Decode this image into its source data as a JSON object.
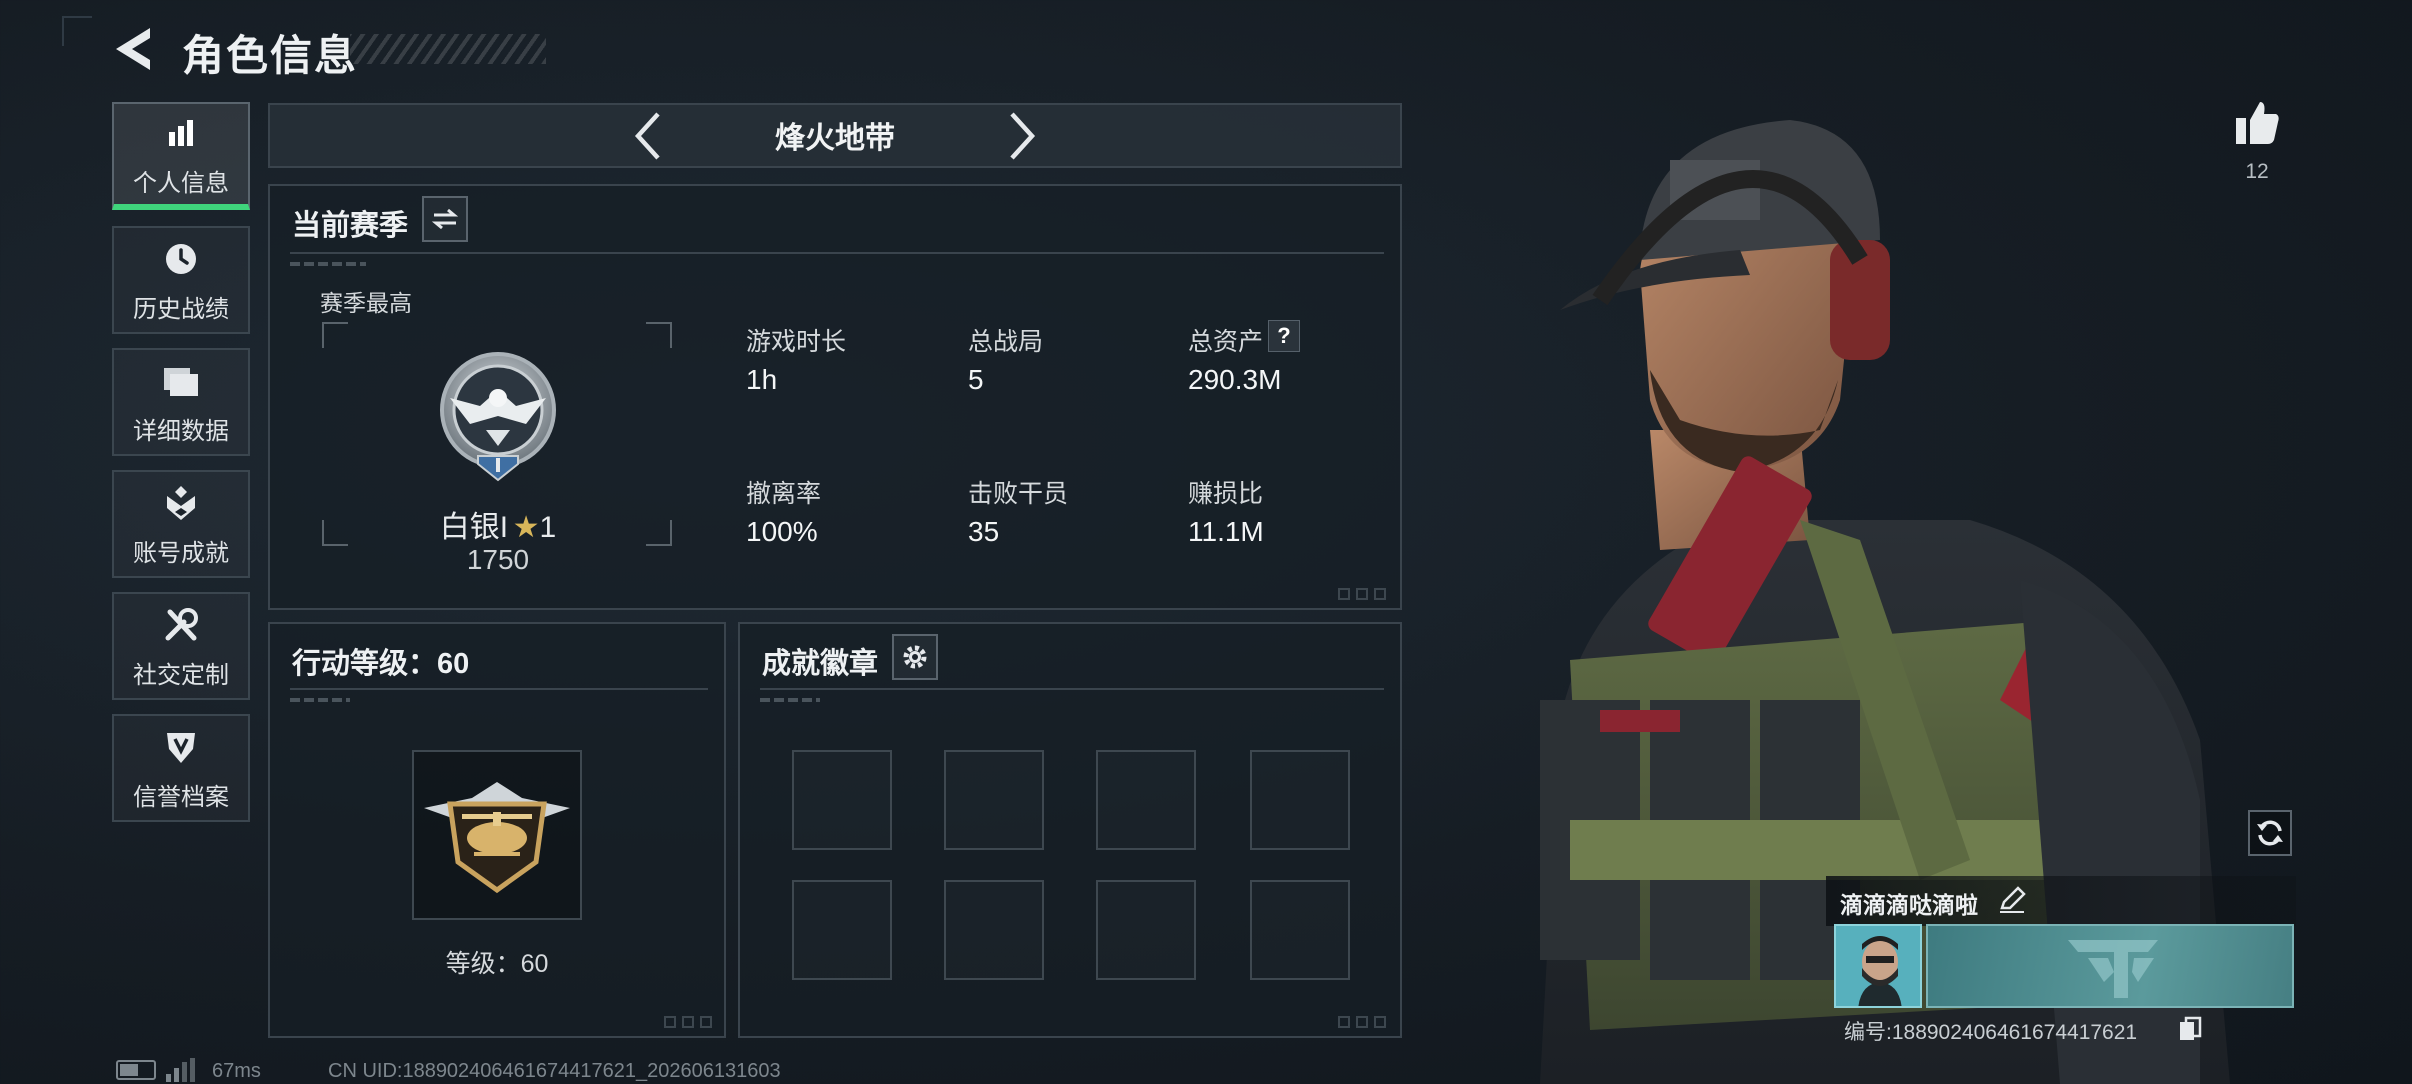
{
  "header": {
    "title": "角色信息",
    "back_icon": "back-arrow-icon"
  },
  "sidebar": {
    "items": [
      {
        "label": "个人信息",
        "icon": "stats-bar-icon",
        "active": true
      },
      {
        "label": "历史战绩",
        "icon": "history-clock-icon",
        "active": false
      },
      {
        "label": "详细数据",
        "icon": "folder-icon",
        "active": false
      },
      {
        "label": "账号成就",
        "icon": "achievement-icon",
        "active": false
      },
      {
        "label": "社交定制",
        "icon": "tools-icon",
        "active": false
      },
      {
        "label": "信誉档案",
        "icon": "credit-shield-icon",
        "active": false
      }
    ]
  },
  "mode_selector": {
    "name": "烽火地带"
  },
  "season": {
    "title": "当前赛季",
    "best_label": "赛季最高",
    "rank_name": "白银I",
    "rank_stars": "1",
    "rank_score": "1750",
    "stats": [
      {
        "label": "游戏时长",
        "value": "1h"
      },
      {
        "label": "总战局",
        "value": "5"
      },
      {
        "label": "总资产",
        "value": "290.3M",
        "help": "?"
      },
      {
        "label": "撤离率",
        "value": "100%"
      },
      {
        "label": "击败干员",
        "value": "35"
      },
      {
        "label": "赚损比",
        "value": "11.1M"
      }
    ]
  },
  "action_level": {
    "title": "行动等级：60",
    "level_text": "等级：60"
  },
  "achievement_badges": {
    "title": "成就徽章",
    "slots": 8
  },
  "profile": {
    "likes": "12",
    "nickname": "滴滴滴哒滴啦",
    "id_text": "编号:1889024064616744176​21"
  },
  "footer": {
    "ping": "67ms",
    "uid_text": "CN UID:188902406461674417621_202606131603"
  },
  "colors": {
    "accent_green": "#3fd57c",
    "panel_border": "#3a444d",
    "card_teal": "#4d8a8e"
  }
}
